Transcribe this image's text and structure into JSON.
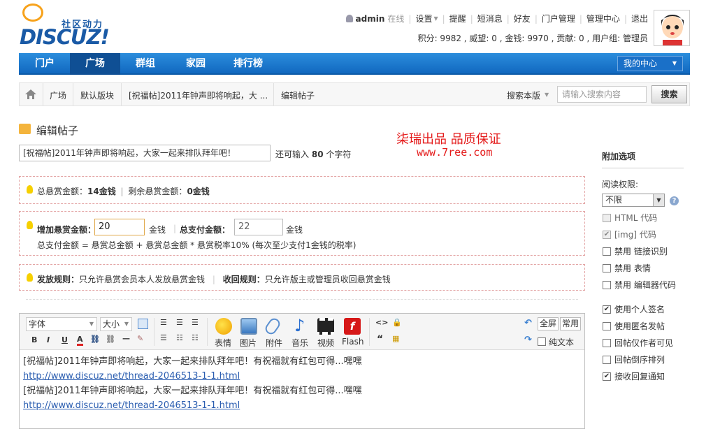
{
  "logo": {
    "word": "DISCUZ!",
    "sub": "社区动力"
  },
  "topnav": {
    "user": "admin",
    "online": "在线",
    "items": [
      "设置",
      "提醒",
      "短消息",
      "好友",
      "门户管理",
      "管理中心",
      "退出"
    ],
    "stats": "积分: 9982 , 威望: 0 , 金钱: 9970 , 贡献: 0 , 用户组: 管理员"
  },
  "nav": {
    "tabs": [
      "门户",
      "广场",
      "群组",
      "家园",
      "排行榜"
    ],
    "active": "广场",
    "mycenter": "我的中心"
  },
  "breadcrumb": {
    "items": [
      "广场",
      "默认版块",
      "[祝福帖]2011年钟声即将响起，大 ...",
      "编辑帖子"
    ],
    "scope": "搜索本版",
    "search_placeholder": "请输入搜索内容",
    "search_button": "搜索"
  },
  "page_title": "编辑帖子",
  "watermark": {
    "line1": "柒瑞出品   品质保证",
    "line2": "www.7ree.com"
  },
  "subject": {
    "value": "[祝福帖]2011年钟声即将响起，大家一起来排队拜年吧！",
    "tip_pre": "还可输入",
    "tip_count": "80",
    "tip_post": "个字符"
  },
  "reward": {
    "summary_label1": "总悬赏金额：",
    "summary_val1": "14金钱",
    "summary_label2": "剩余悬赏金额：",
    "summary_val2": "0金钱",
    "add_label": "增加悬赏金额：",
    "add_value": "20",
    "unit": "金钱",
    "total_label": "总支付金额：",
    "total_value": "22",
    "formula": "总支付金额 = 悬赏总金额 + 悬赏总金额 * 悬赏税率10% (每次至少支付1金钱的税率)",
    "rule_label": "发放规则：",
    "rule_text": "只允许悬赏会员本人发放悬赏金钱",
    "recycle_label": "收回规则：",
    "recycle_text": "只允许版主或管理员收回悬赏金钱"
  },
  "editor": {
    "font_select": "字体",
    "size_select": "大小",
    "buttons": [
      "表情",
      "图片",
      "附件",
      "音乐",
      "视频",
      "Flash"
    ],
    "fullscreen": "全屏",
    "common": "常用",
    "plaintext": "纯文本",
    "lines": [
      "[祝福帖]2011年钟声即将响起，大家一起来排队拜年吧！有祝福就有红包可得...嘿嘿",
      "http://www.discuz.net/thread-2046513-1-1.html",
      "[祝福帖]2011年钟声即将响起，大家一起来排队拜年吧！有祝福就有红包可得...嘿嘿",
      "http://www.discuz.net/thread-2046513-1-1.html"
    ]
  },
  "sidebar": {
    "title": "附加选项",
    "read_perm_label": "阅读权限:",
    "read_perm_value": "不限",
    "options": [
      {
        "label": "HTML 代码",
        "checked": false,
        "disabled": true
      },
      {
        "label": "[img] 代码",
        "checked": true,
        "disabled": true
      },
      {
        "label": "禁用 链接识别",
        "checked": false,
        "disabled": false
      },
      {
        "label": "禁用 表情",
        "checked": false,
        "disabled": false
      },
      {
        "label": "禁用 编辑器代码",
        "checked": false,
        "disabled": false
      },
      {
        "label": "使用个人签名",
        "checked": true,
        "disabled": false
      },
      {
        "label": "使用匿名发帖",
        "checked": false,
        "disabled": false
      },
      {
        "label": "回帖仅作者可见",
        "checked": false,
        "disabled": false
      },
      {
        "label": "回帖倒序排列",
        "checked": false,
        "disabled": false
      },
      {
        "label": "接收回复通知",
        "checked": true,
        "disabled": false
      }
    ]
  },
  "colors": {
    "nav_blue": "#1a6fc4",
    "logo_blue": "#1a5aa6",
    "watermark_red": "#e41a1a",
    "link_blue": "#2a5db0"
  }
}
